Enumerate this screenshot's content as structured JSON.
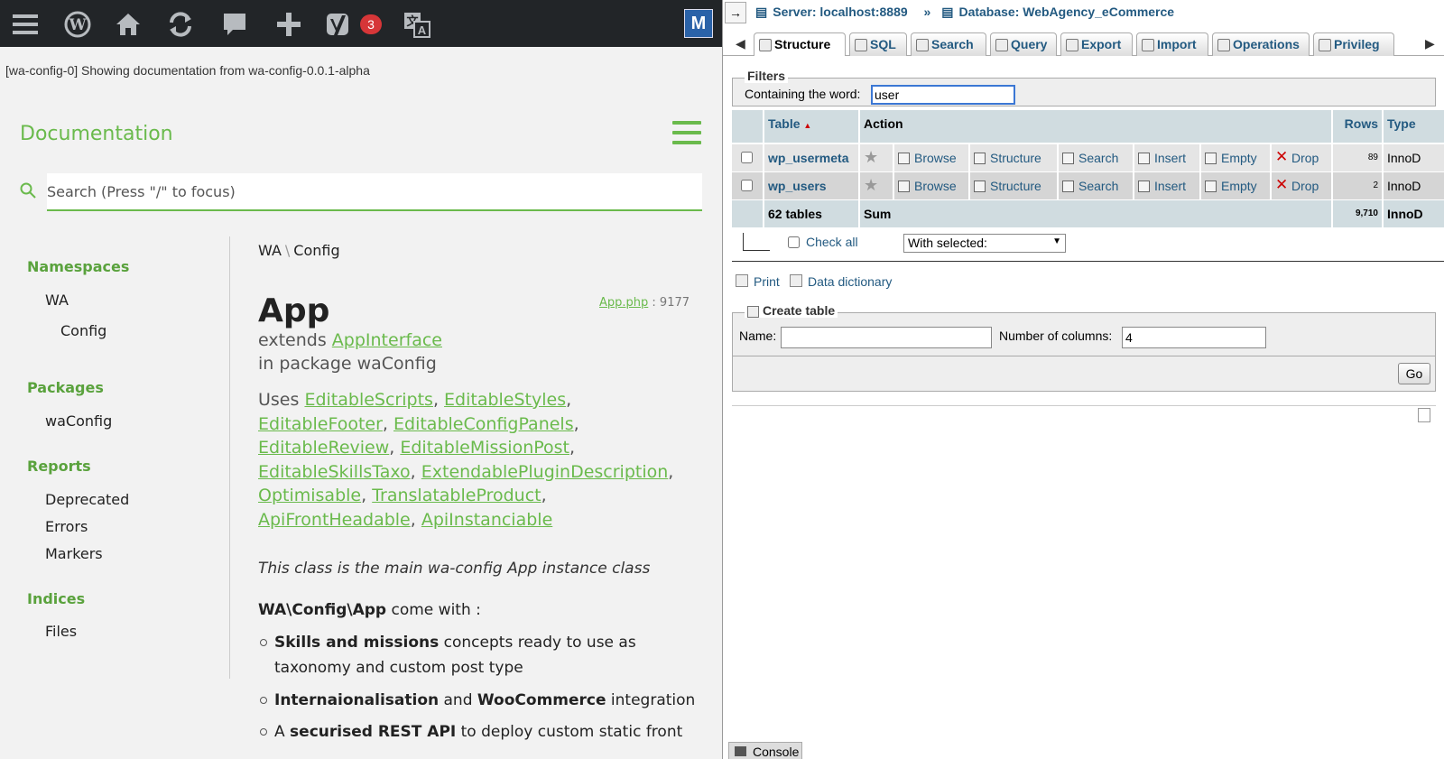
{
  "wp_toolbar": {
    "icons": [
      "menu-icon",
      "wordpress-icon",
      "home-icon",
      "updates-icon",
      "comments-icon",
      "new-icon",
      "yoast-icon",
      "translate-icon"
    ],
    "yoast_badge": "3"
  },
  "notice": "[wa-config-0] Showing documentation from wa-config-0.0.1-alpha",
  "doc": {
    "title": "Documentation",
    "search_placeholder": "Search (Press \"/\" to focus)"
  },
  "sidebar": {
    "namespaces_heading": "Namespaces",
    "namespaces": [
      "WA",
      "Config"
    ],
    "packages_heading": "Packages",
    "packages": [
      "waConfig"
    ],
    "reports_heading": "Reports",
    "reports": [
      "Deprecated",
      "Errors",
      "Markers"
    ],
    "indices_heading": "Indices",
    "indices": [
      "Files"
    ]
  },
  "content": {
    "breadcrumb": [
      "WA",
      "Config"
    ],
    "breadcrumb_sep": "\\",
    "file_link": "App.php",
    "file_line": ": 9177",
    "class_name": "App",
    "extends_prefix": "extends",
    "extends_link": "AppInterface",
    "package_line": "in package waConfig",
    "uses_prefix": "Uses",
    "uses": [
      "EditableScripts",
      "EditableStyles",
      "EditableFooter",
      "EditableConfigPanels",
      "EditableReview",
      "EditableMissionPost",
      "EditableSkillsTaxo",
      "ExtendablePluginDescription",
      "Optimisable",
      "TranslatableProduct",
      "ApiFrontHeadable",
      "ApiInstanciable"
    ],
    "description": "This class is the main wa-config App instance class",
    "comes_with_bold": "WA\\Config\\App",
    "comes_with_rest": " come with :",
    "bullets": [
      {
        "b1": "Skills and missions",
        "t1": " concepts ready to use as taxonomy and custom post type",
        "b2": "",
        "t2": ""
      },
      {
        "b1": "Internaionalisation",
        "t1": " and ",
        "b2": "WooCommerce",
        "t2": " integration"
      },
      {
        "b1": "",
        "t1": "A ",
        "b2": "securised REST API",
        "t2": " to deploy custom static front"
      }
    ]
  },
  "pma": {
    "server": "Server: localhost:8889",
    "database": "Database: WebAgency_eCommerce",
    "tabs": [
      "Structure",
      "SQL",
      "Search",
      "Query",
      "Export",
      "Import",
      "Operations",
      "Privileg"
    ],
    "filters_legend": "Filters",
    "filter_label": "Containing the word:",
    "filter_value": "user",
    "columns": {
      "table": "Table",
      "action": "Action",
      "rows": "Rows",
      "type": "Type"
    },
    "actions": [
      "Browse",
      "Structure",
      "Search",
      "Insert",
      "Empty",
      "Drop"
    ],
    "tables": [
      {
        "name": "wp_usermeta",
        "rows": "89",
        "type": "InnoD"
      },
      {
        "name": "wp_users",
        "rows": "2",
        "type": "InnoD"
      }
    ],
    "summary": {
      "count": "62 tables",
      "sum": "Sum",
      "rows": "9,710",
      "type": "InnoD"
    },
    "check_all": "Check all",
    "with_selected": "With selected:",
    "print": "Print",
    "data_dictionary": "Data dictionary",
    "create_legend": "Create table",
    "name_label": "Name:",
    "name_value": "",
    "cols_label": "Number of columns:",
    "cols_value": "4",
    "go": "Go",
    "console": "Console"
  }
}
